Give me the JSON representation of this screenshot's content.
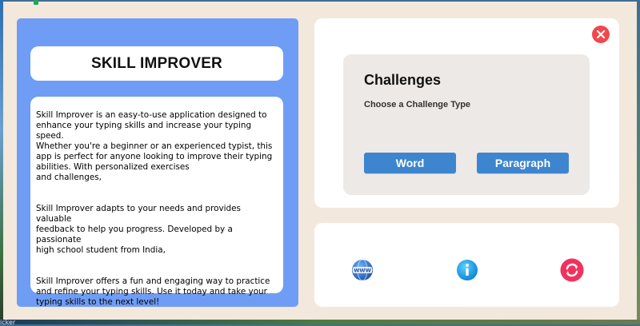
{
  "app": {
    "title": "SKILL IMPROVER"
  },
  "description": {
    "paragraphs": [
      "Skill Improver is an easy-to-use application designed to\nenhance your typing skills and increase your typing speed.\nWhether you're a beginner or an experienced typist, this\napp is perfect for anyone looking to improve their typing\nabilities. With personalized exercises\nand challenges,",
      "Skill Improver adapts to your needs and provides valuable\nfeedback to help you progress. Developed by a passionate\nhigh school student from India,",
      "Skill Improver offers a fun and engaging way to practice\nand refine your typing skills. Use it today and take your\ntyping skills to the next level!"
    ]
  },
  "challenges": {
    "title": "Challenges",
    "subtitle": "Choose a Challenge Type",
    "buttons": {
      "word": "Word",
      "paragraph": "Paragraph"
    }
  },
  "icons": {
    "close": "close-icon",
    "website": "www-globe-icon",
    "info": "info-icon",
    "refresh": "refresh-icon",
    "website_text": "WWW"
  },
  "taskbar": {
    "label": "icker"
  },
  "colors": {
    "left_panel": "#6f9df5",
    "button": "#3d86cf",
    "close": "#f0484d",
    "refresh": "#f0325e",
    "window_bg": "#f3e8dc"
  }
}
